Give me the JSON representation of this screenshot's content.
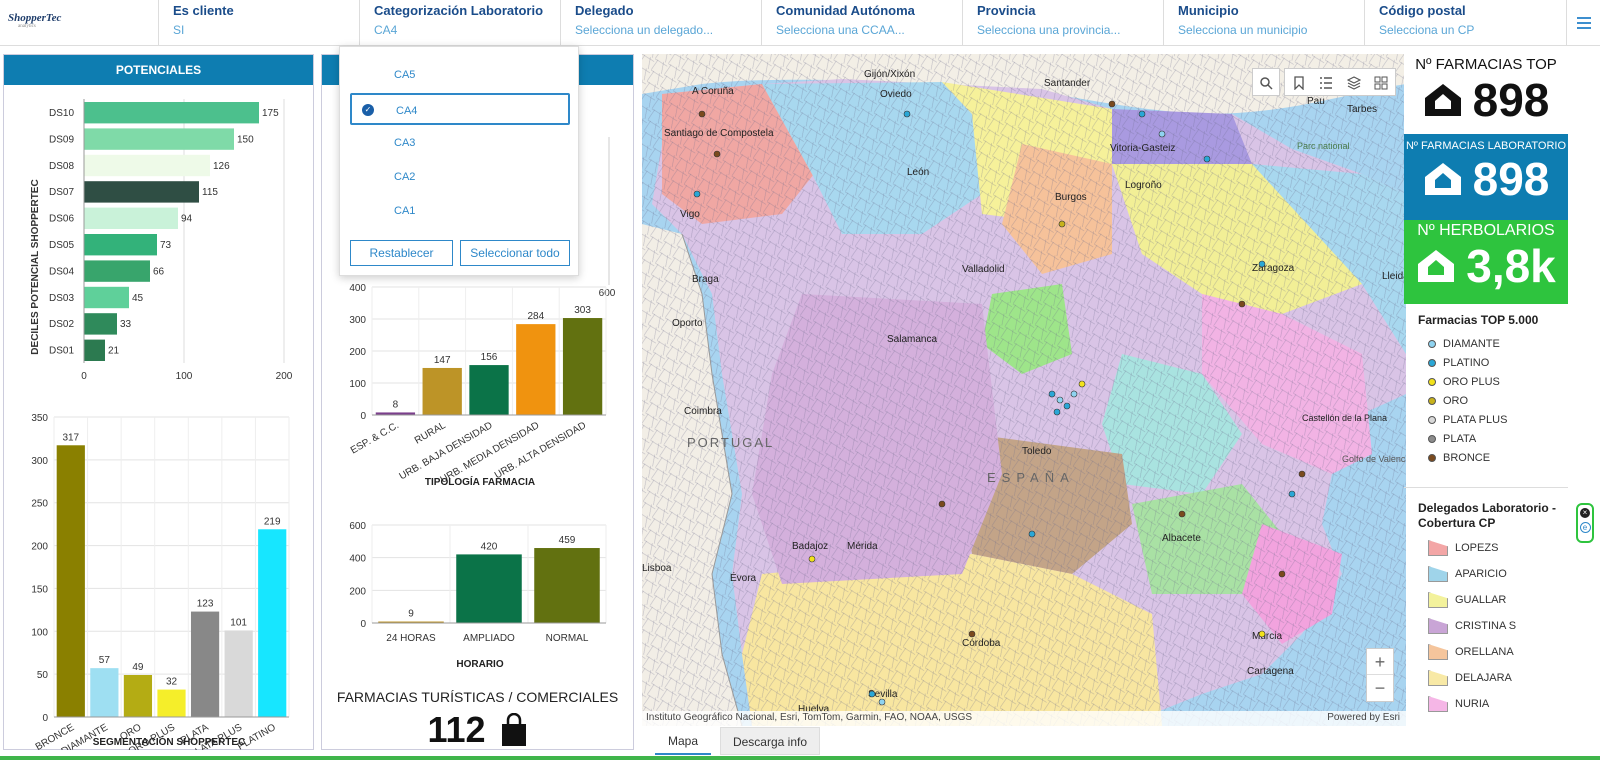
{
  "logo": {
    "name": "ShopperTec",
    "tagline": "analytics"
  },
  "filters": [
    {
      "label": "Es cliente",
      "value": "SI"
    },
    {
      "label": "Categorización Laboratorio",
      "value": "CA4"
    },
    {
      "label": "Delegado",
      "value": "Selecciona un delegado..."
    },
    {
      "label": "Comunidad Autónoma",
      "value": "Selecciona una CCAA..."
    },
    {
      "label": "Provincia",
      "value": "Selecciona una provincia..."
    },
    {
      "label": "Municipio",
      "value": "Selecciona un municipio"
    },
    {
      "label": "Código postal",
      "value": "Selecciona un CP"
    }
  ],
  "dropdown": {
    "options": [
      "CA5",
      "CA4",
      "CA3",
      "CA2",
      "CA1"
    ],
    "selected": "CA4",
    "reset_label": "Restablecer",
    "select_all_label": "Seleccionar todo"
  },
  "potenciales": {
    "title": "POTENCIALES"
  },
  "chart_data": [
    {
      "type": "bar",
      "orientation": "horizontal",
      "ylabel": "DECILES POTENCIAL SHOPPERTEC",
      "categories": [
        "DS10",
        "DS09",
        "DS08",
        "DS07",
        "DS06",
        "DS05",
        "DS04",
        "DS03",
        "DS02",
        "DS01"
      ],
      "values": [
        175,
        150,
        126,
        115,
        94,
        73,
        66,
        45,
        33,
        21
      ],
      "colors": [
        "#4cc08d",
        "#7fdaa8",
        "#eefae8",
        "#2f4e44",
        "#c9f2d9",
        "#33b27a",
        "#38a56c",
        "#5fd09a",
        "#2f8a5b",
        "#2c7a50"
      ],
      "xticks": [
        0,
        100,
        200
      ],
      "xlim": [
        0,
        200
      ]
    },
    {
      "type": "bar",
      "title": "SEGMENTACIÓN SHOPPERTEC",
      "categories": [
        "BRONCE",
        "DIAMANTE",
        "ORO",
        "ORO PLUS",
        "PLATA",
        "PLATA PLUS",
        "PLATINO"
      ],
      "values": [
        317,
        57,
        49,
        32,
        123,
        101,
        219
      ],
      "colors": [
        "#8a8000",
        "#9edff2",
        "#b4ac14",
        "#f5ee2a",
        "#888888",
        "#d9d9d9",
        "#17e6ff"
      ],
      "yticks": [
        0,
        50,
        100,
        150,
        200,
        250,
        300,
        350
      ],
      "ylim": [
        0,
        350
      ]
    },
    {
      "type": "bar",
      "title": "TIPOLOGÍA FARMACIA",
      "categories": [
        "ESP. & C.C.",
        "RURAL",
        "URB. BAJA DENSIDAD",
        "URB. MEDIA DENSIDAD",
        "URB. ALTA DENSIDAD"
      ],
      "values": [
        8,
        147,
        156,
        284,
        303
      ],
      "colors": [
        "#7b3f8c",
        "#bd9427",
        "#0b7348",
        "#f0930f",
        "#627110"
      ],
      "yticks": [
        0,
        100,
        200,
        300,
        400
      ],
      "ylim": [
        0,
        400
      ]
    },
    {
      "type": "bar",
      "title": "HORARIO",
      "categories": [
        "24 HORAS",
        "AMPLIADO",
        "NORMAL"
      ],
      "values": [
        9,
        420,
        459
      ],
      "colors": [
        "#bd9427",
        "#0b7348",
        "#627110"
      ],
      "yticks": [
        0,
        200,
        400,
        600
      ],
      "ylim": [
        0,
        600
      ]
    }
  ],
  "hidden_chart_tick": "600",
  "turisticas": {
    "title": "FARMACIAS TURÍSTICAS / COMERCIALES",
    "value": "112"
  },
  "map": {
    "labels": [
      "A Coruña",
      "Santiago de Compostela",
      "Vigo",
      "Gijón/Xixón",
      "Oviedo",
      "Santander",
      "Vitoria-Gasteiz",
      "Logroño",
      "León",
      "Burgos",
      "Valladolid",
      "Zaragoza",
      "Braga",
      "Oporto",
      "Salamanca",
      "Coimbra",
      "PORTUGAL",
      "Toledo",
      "ESPAÑA",
      "Castellón de la Plana",
      "Golfo de Valencia",
      "Badajoz",
      "Mérida",
      "Évora",
      "Albacete",
      "Murcia",
      "Cartagena",
      "Córdoba",
      "Sevilla",
      "Huelva",
      "Pau",
      "Tarbes",
      "Parc national",
      "Lisboa",
      "Lleida"
    ],
    "attribution": "Instituto Geográfico Nacional, Esri, TomTom, Garmin, FAO, NOAA, USGS",
    "powered": "Powered by Esri",
    "zoom_in": "+",
    "zoom_out": "−"
  },
  "tabs": [
    "Mapa",
    "Descarga info"
  ],
  "kpis": [
    {
      "title": "Nº FARMACIAS TOP",
      "value": "898",
      "bg": "#ffffff",
      "fg": "#111111"
    },
    {
      "title": "Nº FARMACIAS LABORATORIO",
      "value": "898",
      "bg": "#0e7db1",
      "fg": "#ffffff"
    },
    {
      "title": "Nº HERBOLARIOS",
      "value": "3,8k",
      "bg": "#2ec43e",
      "fg": "#ffffff"
    }
  ],
  "legend_top": {
    "title": "Farmacias TOP 5.000",
    "items": [
      {
        "label": "DIAMANTE",
        "color": "#8fd3f0"
      },
      {
        "label": "PLATINO",
        "color": "#2aa7d6"
      },
      {
        "label": "ORO PLUS",
        "color": "#f2e21b"
      },
      {
        "label": "ORO",
        "color": "#c7b21b"
      },
      {
        "label": "PLATA PLUS",
        "color": "#d8d8d8"
      },
      {
        "label": "PLATA",
        "color": "#8c8c8c"
      },
      {
        "label": "BRONCE",
        "color": "#7a4a1e"
      }
    ]
  },
  "legend_delegados": {
    "title": "Delegados Laboratorio - Cobertura CP",
    "items": [
      {
        "label": "LOPEZS",
        "color": "#f3a6a6"
      },
      {
        "label": "APARICIO",
        "color": "#9fd4ea"
      },
      {
        "label": "GUALLAR",
        "color": "#f3f29c"
      },
      {
        "label": "CRISTINA S",
        "color": "#c9a5d6"
      },
      {
        "label": "ORELLANA",
        "color": "#f5c59c"
      },
      {
        "label": "DELAJARA",
        "color": "#f8e9a6"
      },
      {
        "label": "NURIA",
        "color": "#f5b6e6"
      }
    ]
  }
}
